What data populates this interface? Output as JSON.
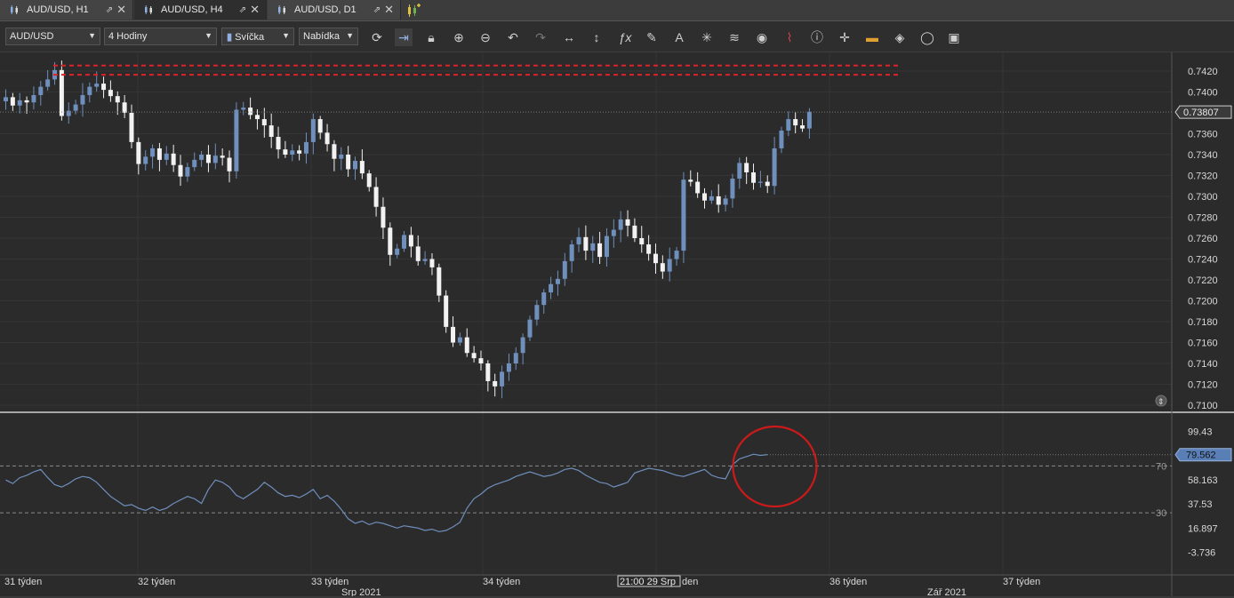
{
  "tabs": [
    {
      "label": "AUD/USD, H1",
      "active": false
    },
    {
      "label": "AUD/USD, H4",
      "active": true
    },
    {
      "label": "AUD/USD, D1",
      "active": false
    }
  ],
  "toolbar": {
    "symbol": "AUD/USD",
    "timeframe": "4 Hodiny",
    "chart_type": "Svíčka",
    "price_side": "Nabídka",
    "tools": [
      "refresh-icon",
      "scroll-to-end-icon",
      "lock-icon",
      "zoom-in-icon",
      "zoom-out-icon",
      "undo-icon",
      "redo-icon",
      "horizontal-resize-icon",
      "vertical-resize-icon",
      "fx-indicator-icon",
      "pencil-icon",
      "text-tool-icon",
      "pattern-icon",
      "layers-icon",
      "eye-icon",
      "alert-chart-icon",
      "info-icon",
      "crosshair-icon",
      "ruler-icon",
      "fill-icon",
      "cycle-icon",
      "save-icon"
    ]
  },
  "colors": {
    "bull": "#6f8fbd",
    "bear": "#f2f2f2",
    "rsi": "#6f8fbd",
    "resistance": "#e0202a",
    "circle": "#cc1a1a",
    "bg": "#2b2b2b"
  },
  "chart_data": [
    {
      "type": "candlestick",
      "symbol": "AUD/USD",
      "timeframe": "H4",
      "ylim": [
        0.71,
        0.743
      ],
      "y_ticks": [
        "0.7420",
        "0.7400",
        "0.7360",
        "0.7340",
        "0.7320",
        "0.7300",
        "0.7280",
        "0.7260",
        "0.7240",
        "0.7220",
        "0.7200",
        "0.7180",
        "0.7160",
        "0.7140",
        "0.7120",
        "0.7100"
      ],
      "last_price_label": "0.73807",
      "last_price": 0.73807,
      "resistance_levels": [
        0.74253,
        0.74165
      ],
      "closes": [
        0.7395,
        0.7387,
        0.7392,
        0.739,
        0.7397,
        0.7405,
        0.7412,
        0.7421,
        0.7377,
        0.7382,
        0.7388,
        0.7397,
        0.7405,
        0.7408,
        0.7402,
        0.7396,
        0.739,
        0.738,
        0.7352,
        0.7331,
        0.7338,
        0.7346,
        0.7335,
        0.7341,
        0.733,
        0.7319,
        0.7328,
        0.7335,
        0.734,
        0.7332,
        0.7339,
        0.7337,
        0.7324,
        0.7383,
        0.7385,
        0.7378,
        0.7374,
        0.7368,
        0.7357,
        0.7345,
        0.734,
        0.7344,
        0.7341,
        0.7352,
        0.7374,
        0.7361,
        0.735,
        0.7336,
        0.734,
        0.7326,
        0.7334,
        0.7322,
        0.7309,
        0.729,
        0.727,
        0.7244,
        0.725,
        0.7263,
        0.7252,
        0.7238,
        0.724,
        0.7232,
        0.7205,
        0.7175,
        0.716,
        0.7165,
        0.715,
        0.7145,
        0.714,
        0.7123,
        0.7118,
        0.7132,
        0.714,
        0.715,
        0.7165,
        0.7182,
        0.7196,
        0.7208,
        0.7216,
        0.7221,
        0.7238,
        0.7254,
        0.7261,
        0.7248,
        0.7255,
        0.7242,
        0.7262,
        0.7268,
        0.7278,
        0.7272,
        0.726,
        0.7254,
        0.7245,
        0.7236,
        0.7228,
        0.724,
        0.7248,
        0.7316,
        0.7314,
        0.7303,
        0.7296,
        0.73,
        0.7292,
        0.7298,
        0.7317,
        0.7332,
        0.7323,
        0.7313,
        0.7314,
        0.731,
        0.7346,
        0.7363,
        0.7374,
        0.7368,
        0.7365,
        0.7381
      ],
      "x_tick_labels": [
        "31 týden",
        "32 týden",
        "33 týden",
        "34 týden",
        "36 týden",
        "37 týden"
      ],
      "month_labels": [
        "Srp 2021",
        "Zář 2021"
      ],
      "crosshair_time": "21:00 29 Srp",
      "crosshair_suffix": "den"
    },
    {
      "type": "line",
      "indicator": "RSI",
      "ylim": [
        -10,
        108
      ],
      "y_ticks": [
        "99.43",
        "58.163",
        "37.53",
        "16.897",
        "-3.736"
      ],
      "levels": [
        {
          "value": 70,
          "label": "70"
        },
        {
          "value": 30,
          "label": "30"
        }
      ],
      "last_value_label": "79.562",
      "last_value": 79.562,
      "values": [
        58,
        55,
        60,
        62,
        65,
        67,
        60,
        54,
        52,
        55,
        59,
        61,
        60,
        56,
        50,
        44,
        40,
        36,
        37,
        34,
        32,
        35,
        32,
        34,
        38,
        41,
        44,
        42,
        38,
        50,
        58,
        56,
        52,
        45,
        42,
        46,
        50,
        56,
        52,
        47,
        44,
        45,
        43,
        46,
        50,
        42,
        45,
        40,
        33,
        25,
        21,
        23,
        20,
        22,
        21,
        19,
        17,
        19,
        18,
        17,
        15,
        16,
        14,
        15,
        18,
        22,
        34,
        42,
        46,
        51,
        54,
        56,
        58,
        61,
        63,
        65,
        63,
        61,
        62,
        64,
        67,
        68,
        66,
        62,
        59,
        56,
        55,
        52,
        54,
        56,
        64,
        66,
        68,
        67,
        66,
        64,
        62,
        61,
        63,
        65,
        67,
        62,
        60,
        59,
        71,
        76,
        78,
        80,
        79,
        79.562
      ],
      "highlight_circle": {
        "from_bar": 102,
        "to_bar": 113,
        "label": ""
      }
    }
  ]
}
